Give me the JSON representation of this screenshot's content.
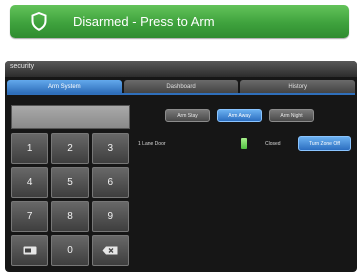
{
  "banner": {
    "label": "Disarmed - Press to Arm",
    "icon": "shield-icon",
    "color": "#3fa23d"
  },
  "panel": {
    "title": "security",
    "tabs": [
      {
        "label": "Arm System",
        "active": true
      },
      {
        "label": "Dashboard",
        "active": false
      },
      {
        "label": "History",
        "active": false
      }
    ],
    "keypad": {
      "keys": [
        "1",
        "2",
        "3",
        "4",
        "5",
        "6",
        "7",
        "8",
        "9",
        "",
        "0",
        ""
      ],
      "icons": {
        "bottom_left": "card-icon",
        "bottom_right": "backspace-icon"
      }
    },
    "arm_buttons": [
      {
        "label": "Arm Stay",
        "active": false
      },
      {
        "label": "Arm Away",
        "active": true
      },
      {
        "label": "Arm Night",
        "active": false
      }
    ],
    "zone": {
      "name": "1 Lane Door",
      "status": "Closed",
      "button_label": "Turn Zone Off"
    },
    "accent": "#2f6fbb"
  }
}
